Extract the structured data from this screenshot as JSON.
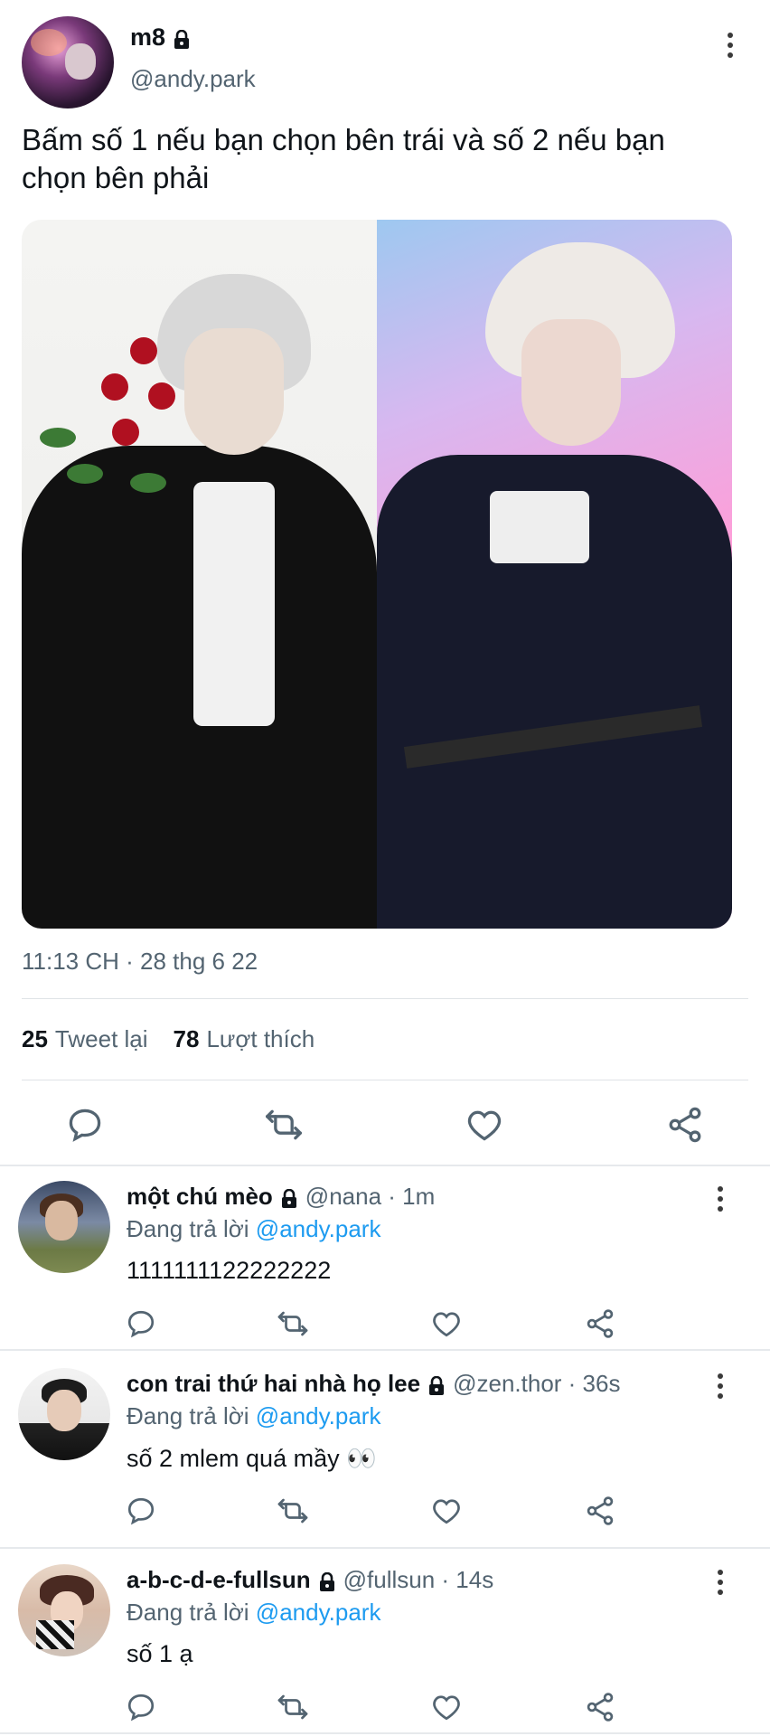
{
  "tweet": {
    "author_name": "m8",
    "author_handle": "@andy.park",
    "text": "Bấm số 1 nếu bạn chọn bên trái và số 2 nếu bạn chọn bên phải",
    "timestamp": "11:13 CH · 28 thg 6 22",
    "retweets_count": "25",
    "retweets_label": "Tweet lại",
    "likes_count": "78",
    "likes_label": "Lượt thích"
  },
  "replies": [
    {
      "name": "một chú mèo",
      "meta": "@nana · 1m",
      "replying_prefix": "Đang trả lời",
      "replying_to": "@andy.park",
      "text": "1111111122222222"
    },
    {
      "name": "con trai thứ hai nhà họ lee",
      "meta": "@zen.thor · 36s",
      "replying_prefix": "Đang trả lời",
      "replying_to": "@andy.park",
      "text": "số 2 mlem quá mầy 👀"
    },
    {
      "name": "a-b-c-d-e-fullsun",
      "meta": "@fullsun · 14s",
      "replying_prefix": "Đang trả lời",
      "replying_to": "@andy.park",
      "text": "số 1 ạ"
    }
  ],
  "icons": [
    "lock-icon",
    "more-icon",
    "reply-icon",
    "retweet-icon",
    "like-icon",
    "share-icon"
  ],
  "colors": {
    "text": "#0f1419",
    "secondary": "#536471",
    "mention": "#1d9bf0",
    "divider": "#dfe3e6"
  }
}
